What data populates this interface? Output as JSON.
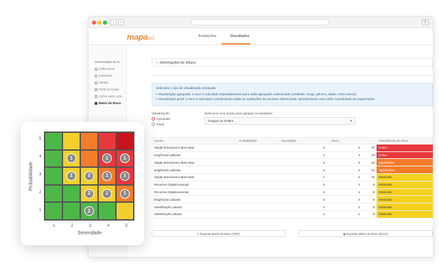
{
  "header": {
    "tabs": [
      "Avaliações",
      "Resultados"
    ],
    "active_tab": "Resultados",
    "logo_text": "mapa",
    "logo_suffix": "nr1"
  },
  "sidebar": {
    "title": "Gerenciador de R...",
    "items": [
      {
        "label": "Visão Geral",
        "icon": "dashboard-icon"
      },
      {
        "label": "Individual",
        "icon": "person-icon"
      },
      {
        "label": "Alertas",
        "icon": "alert-icon"
      },
      {
        "label": "Perfil do Grupo",
        "icon": "group-icon"
      },
      {
        "label": "Ações para contr...",
        "icon": "actions-icon"
      },
      {
        "label": "Matriz de Risco",
        "icon": "matrix-icon",
        "active": true
      }
    ]
  },
  "info_section": {
    "label": "Informações de leitura"
  },
  "visualization_info": {
    "title": "Selecione o tipo de visualização desejada.",
    "bullets": [
      "Visualização agrupada: o risco é calculado separadamente para cada agrupador selecionado (Unidade, cargo, gênero, idade, entre outros).",
      "Visualização geral: o risco é calculado considerando todas as avaliações da amostra selecionada, apresentando uma visão consolidada da organização."
    ]
  },
  "visualizacao": {
    "label": "Visualização:",
    "options": [
      "Agrupada",
      "Geral"
    ],
    "selected": "Agrupada"
  },
  "grouping": {
    "label": "Selecione uma opção para agrupar os avaliados:",
    "value": "Grupos ou GHE's"
  },
  "table": {
    "headers": [
      "Escala",
      "Probabilidade",
      "Severidade",
      "Risco",
      "Classificação do Risco"
    ],
    "rows": [
      {
        "escala": "Saúde Emocional e Bem-estar",
        "prob": "",
        "sev": "4",
        "risco_pre": "5",
        "risco": "20",
        "classificacao": "Crítico",
        "color": "#e8383d"
      },
      {
        "escala": "Exigências Laborais",
        "prob": "",
        "sev": "4",
        "risco_pre": "4",
        "risco": "16",
        "classificacao": "Crítico",
        "color": "#e8383d"
      },
      {
        "escala": "Saúde Emocional e Bem-estar",
        "prob": "",
        "sev": "3",
        "risco_pre": "5",
        "risco": "15",
        "classificacao": "Significativo",
        "color": "#f57c2b"
      },
      {
        "escala": "Exigências Laborais",
        "prob": "",
        "sev": "3",
        "risco_pre": "4",
        "risco": "12",
        "classificacao": "Significativo",
        "color": "#f57c2b"
      },
      {
        "escala": "Saúde Emocional e Bem-estar",
        "prob": "",
        "sev": "2",
        "risco_pre": "5",
        "risco": "10",
        "classificacao": "Moderado",
        "color": "#f6d11f"
      },
      {
        "escala": "Recursos Organizacionais",
        "prob": "",
        "sev": "3",
        "risco_pre": "3",
        "risco": "9",
        "classificacao": "Moderado",
        "color": "#f6d11f"
      },
      {
        "escala": "Recursos Organizacionais",
        "prob": "",
        "sev": "3",
        "risco_pre": "3",
        "risco": "9",
        "classificacao": "Moderado",
        "color": "#f6d11f"
      },
      {
        "escala": "Exigências Laborais",
        "prob": "",
        "sev": "3",
        "risco_pre": "3",
        "risco": "9",
        "classificacao": "Moderado",
        "color": "#f6d11f"
      },
      {
        "escala": "Identificação Laboral",
        "prob": "",
        "sev": "4",
        "risco_pre": "2",
        "risco": "8",
        "classificacao": "Moderado",
        "color": "#f6d11f"
      },
      {
        "escala": "Identificação Laboral",
        "prob": "",
        "sev": "4",
        "risco_pre": "2",
        "risco": "8",
        "classificacao": "Moderado",
        "color": "#f6d11f"
      }
    ]
  },
  "buttons": {
    "export_pdf": "Exportar Matriz de Risco (PDF)",
    "export_excel": "Exportar Matriz de Risco (Excel)"
  },
  "matrix": {
    "ylabel": "Probabilidade",
    "xlabel": "Severidade",
    "yticks": [
      "5",
      "4",
      "3",
      "2",
      "1"
    ],
    "xticks": [
      "1",
      "2",
      "3",
      "4",
      "5"
    ],
    "cells": [
      [
        "#4cb848",
        "#f3cf2e",
        "#f57c2b",
        "#e8383d",
        "#c8141c"
      ],
      [
        "#4cb848",
        "#f3cf2e",
        "#f57c2b",
        "#e8383d",
        "#e8383d"
      ],
      [
        "#4cb848",
        "#f3cf2e",
        "#f3cf2e",
        "#f57c2b",
        "#e8383d"
      ],
      [
        "#4cb848",
        "#4cb848",
        "#f3cf2e",
        "#f3cf2e",
        "#f57c2b"
      ],
      [
        "#4cb848",
        "#4cb848",
        "#4cb848",
        "#4cb848",
        "#f3cf2e"
      ]
    ],
    "badges": [
      {
        "row": 1,
        "col": 1,
        "count": "1"
      },
      {
        "row": 1,
        "col": 3,
        "count": "1"
      },
      {
        "row": 1,
        "col": 4,
        "count": "1"
      },
      {
        "row": 2,
        "col": 1,
        "count": "2"
      },
      {
        "row": 2,
        "col": 2,
        "count": "2"
      },
      {
        "row": 2,
        "col": 3,
        "count": "1"
      },
      {
        "row": 2,
        "col": 4,
        "count": "1"
      },
      {
        "row": 3,
        "col": 2,
        "count": "2"
      },
      {
        "row": 3,
        "col": 3,
        "count": "1"
      },
      {
        "row": 3,
        "col": 4,
        "count": "1"
      },
      {
        "row": 4,
        "col": 2,
        "count": "2"
      }
    ]
  }
}
